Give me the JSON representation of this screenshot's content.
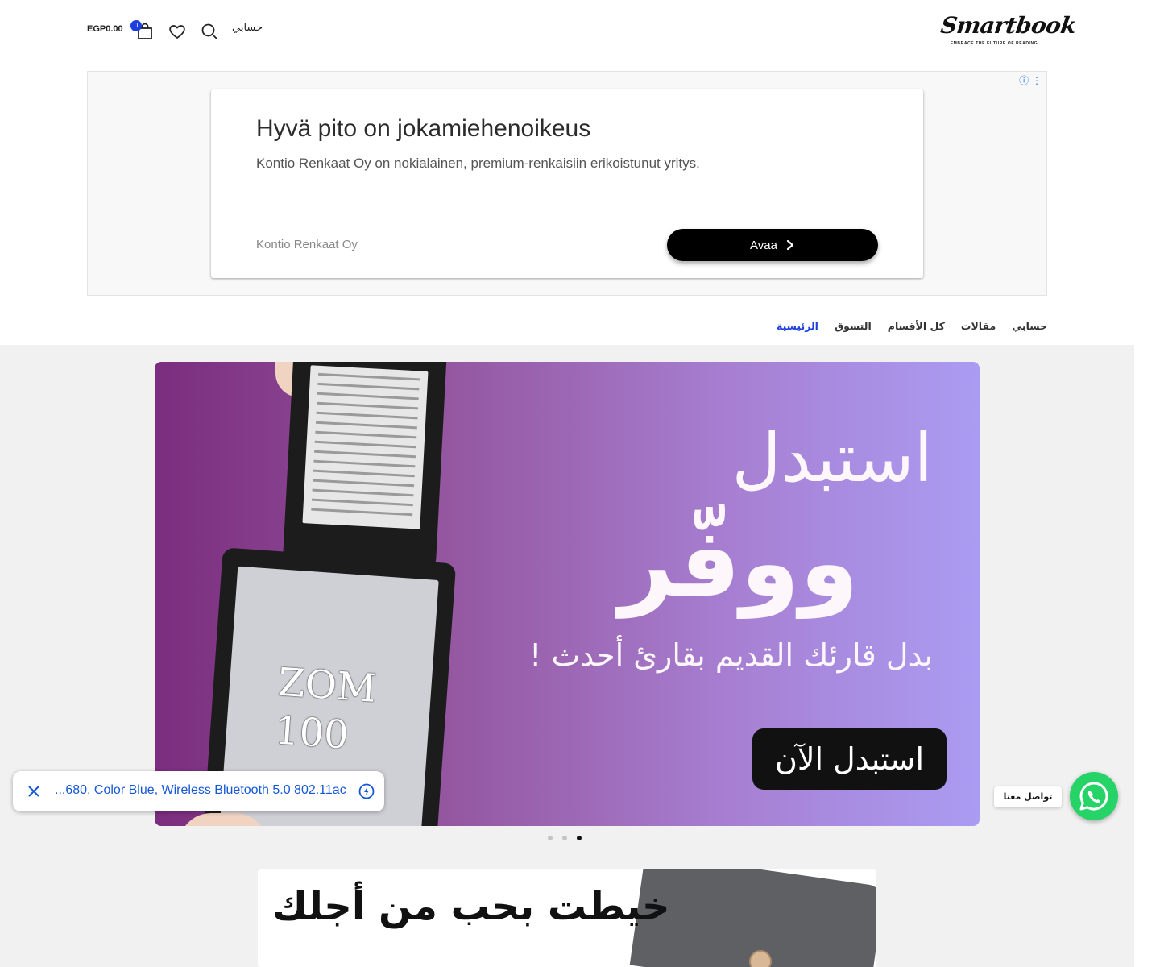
{
  "header": {
    "logo_text": "Smartbook",
    "logo_tagline": "EMBRACE THE FUTURE OF READING",
    "account_label": "حسابي",
    "cart_count": "0",
    "cart_total": "EGP0.00"
  },
  "ad": {
    "title": "Hyvä pito on jokamiehenoikeus",
    "description": "Kontio Renkaat Oy on nokialainen, premium-renkaisiin erikoistunut yritys.",
    "advertiser": "Kontio Renkaat Oy",
    "button_label": "Avaa",
    "choices_icons": "ⓘ ⋮"
  },
  "nav": {
    "items": [
      {
        "label": "الرئيسية",
        "active": true
      },
      {
        "label": "التسوق"
      },
      {
        "label": "كل الأقسام"
      },
      {
        "label": "مقالات"
      },
      {
        "label": "حسابي"
      }
    ]
  },
  "hero": {
    "line1": "استبدل",
    "line2": "ووفّر",
    "line3": "بدل قارئك القديم بقارئ أحدث !",
    "cta": "استبدل الآن",
    "device_label": "ZOM 100",
    "slides_total": 3,
    "active_slide": 3
  },
  "promo": {
    "text": "خيطت بحب من أجلك"
  },
  "toast": {
    "text": "...680, Color Blue, Wireless Bluetooth 5.0 802.11ac"
  },
  "whatsapp": {
    "label": "تواصل معنا"
  },
  "colors": {
    "accent": "#1e3fe0",
    "whatsapp": "#25d366",
    "hero_start": "#7b2d7e",
    "hero_end": "#aa9cf2"
  }
}
